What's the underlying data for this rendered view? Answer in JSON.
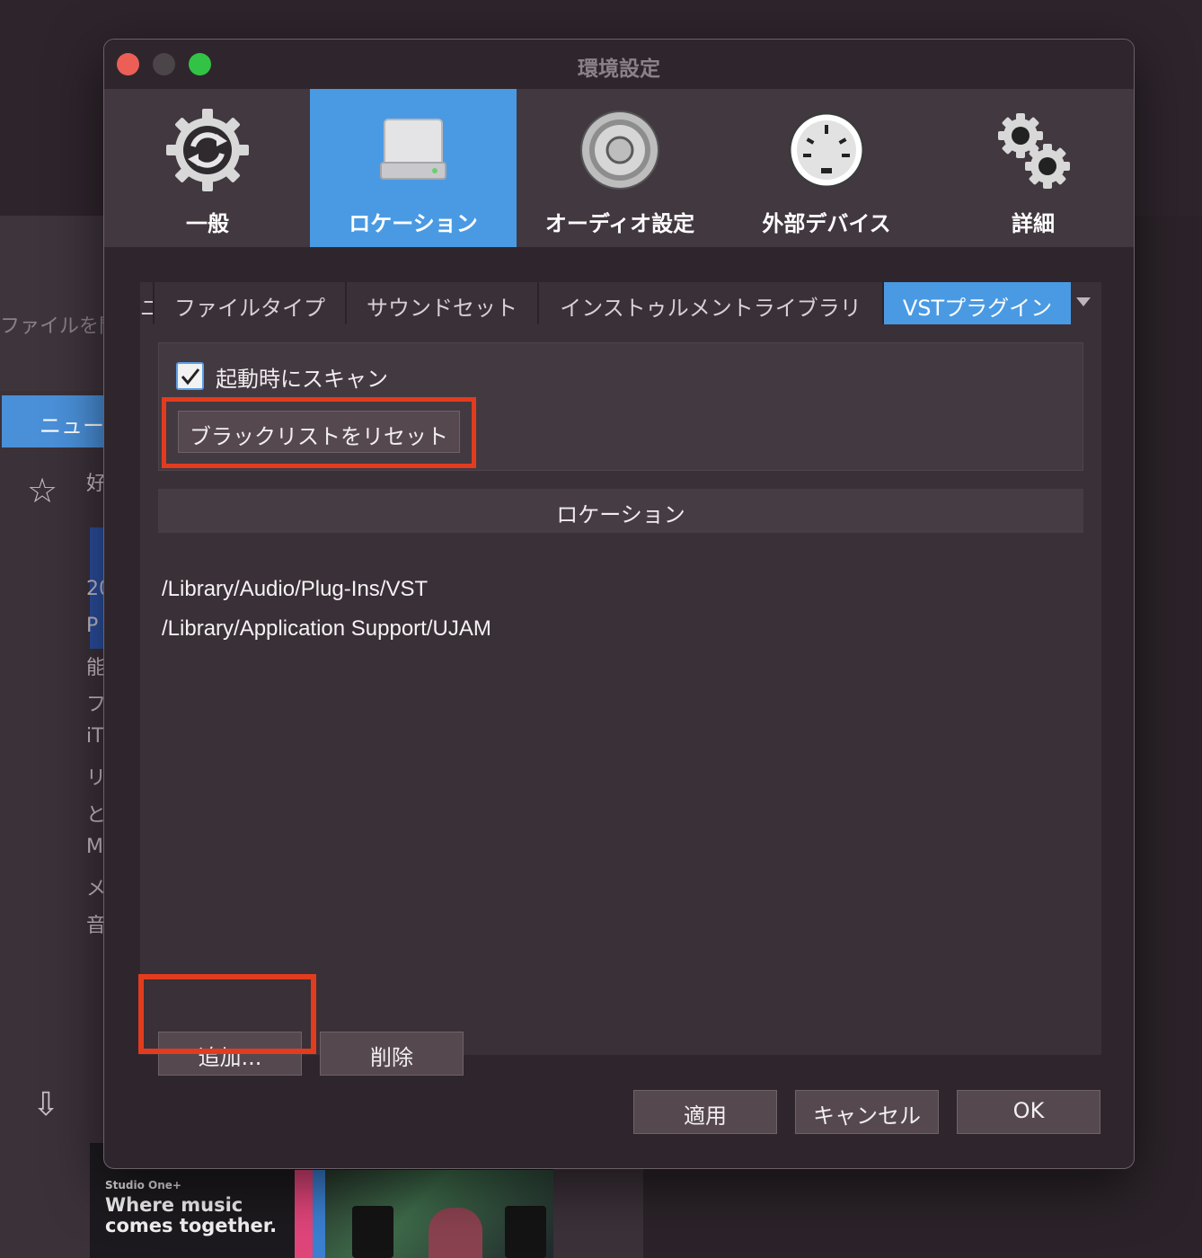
{
  "background": {
    "left_text": "ファイルを開",
    "news_tab_label": "ニュース",
    "feed_lines": [
      "好",
      "",
      "",
      "20",
      "P",
      "能",
      "フ",
      "iT",
      "リ",
      "と",
      "M",
      "メ",
      "音"
    ],
    "promo_brand": "Studio One+",
    "promo_headline_1": "Where music",
    "promo_headline_2": "comes together."
  },
  "dialog": {
    "title": "環境設定",
    "toolbar": [
      {
        "label": "一般",
        "icon": "gear-refresh-icon",
        "active": false
      },
      {
        "label": "ロケーション",
        "icon": "drive-icon",
        "active": true
      },
      {
        "label": "オーディオ設定",
        "icon": "speaker-icon",
        "active": false
      },
      {
        "label": "外部デバイス",
        "icon": "midi-port-icon",
        "active": false
      },
      {
        "label": "詳細",
        "icon": "gears-icon",
        "active": false
      }
    ],
    "subtabs": {
      "clipped_prefix": "ユ",
      "items": [
        "ファイルタイプ",
        "サウンドセット",
        "インストゥルメントライブラリ",
        "VSTプラグイン"
      ],
      "active_index": 3
    },
    "options": {
      "scan_on_startup_label": "起動時にスキャン",
      "scan_on_startup_checked": true,
      "reset_blacklist_label": "ブラックリストをリセット"
    },
    "locations": {
      "header": "ロケーション",
      "rows": [
        "/Library/Audio/Plug-Ins/VST",
        "/Library/Application Support/UJAM"
      ]
    },
    "add_label": "追加...",
    "remove_label": "削除",
    "footer": {
      "apply_label": "適用",
      "cancel_label": "キャンセル",
      "ok_label": "OK"
    },
    "colors": {
      "accent": "#4a9ae3",
      "highlight": "#e23c1f"
    }
  }
}
